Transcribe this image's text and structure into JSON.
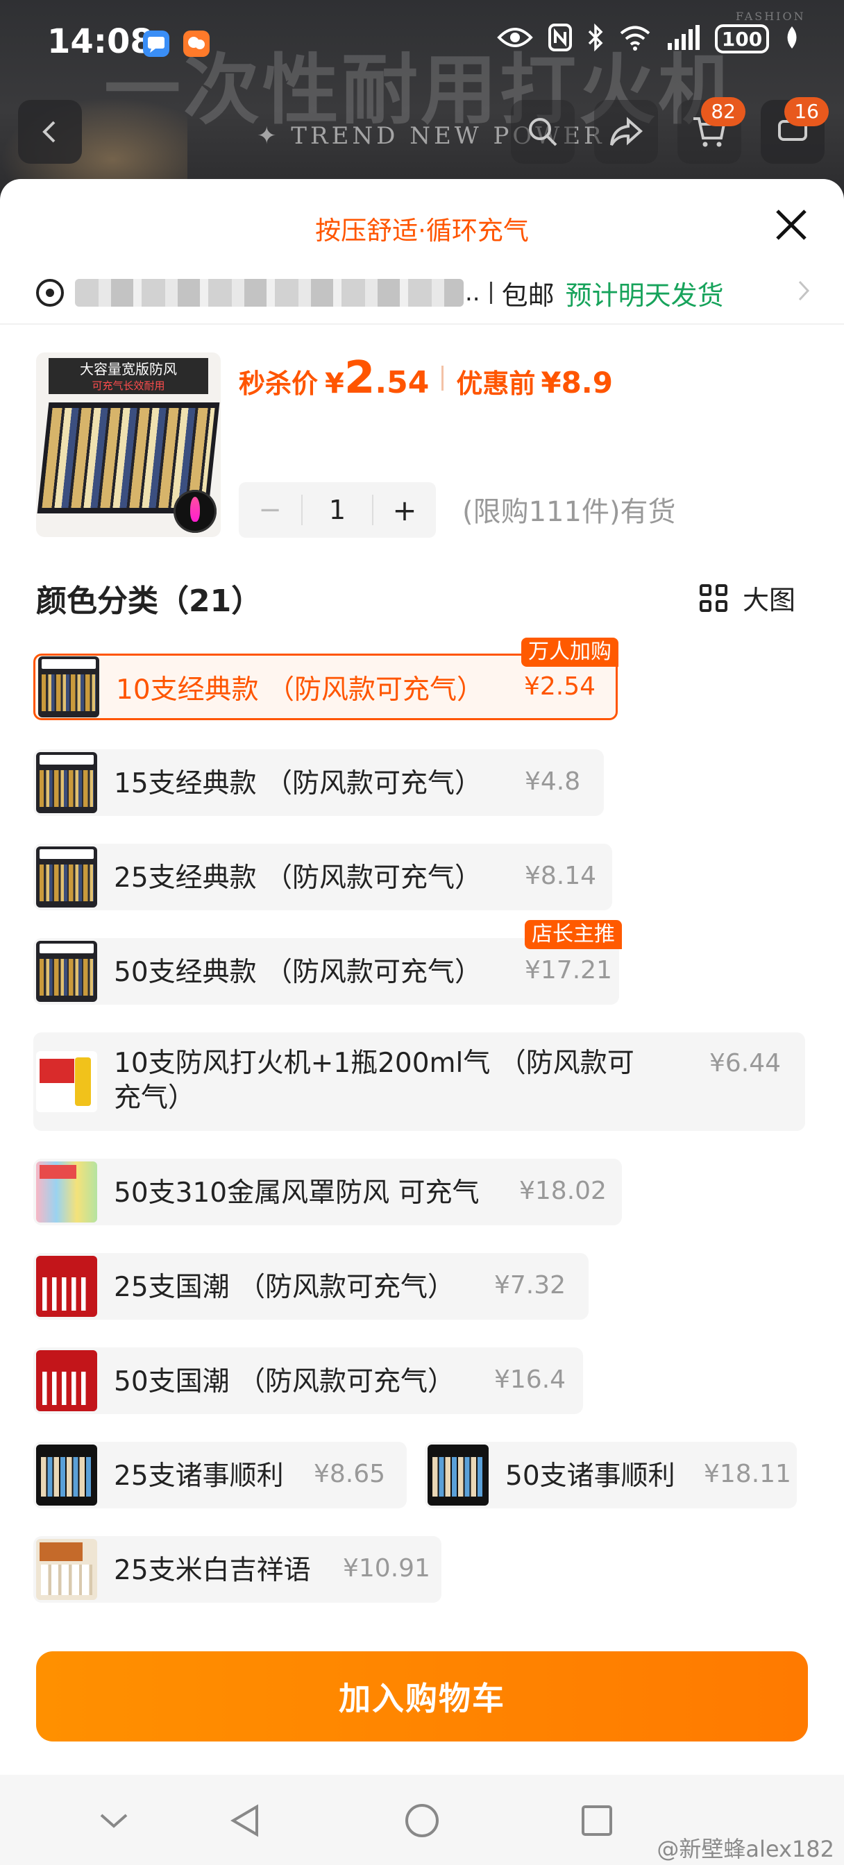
{
  "status_bar": {
    "time": "14:08",
    "battery": "100",
    "icons": [
      "message-icon",
      "chat-app-icon",
      "eye-icon",
      "nfc-icon",
      "bluetooth-icon",
      "wifi-icon",
      "signal-icon",
      "leaf-icon"
    ]
  },
  "background": {
    "banner_text": "一次性耐用打火机",
    "banner_sub": "✦ TREND NEW POWER",
    "fashion_mark": "FASHION"
  },
  "page_nav": {
    "cart_badge": "82",
    "msg_badge": "16"
  },
  "sheet": {
    "title": "按压舒适·循环充气",
    "address": {
      "ellipsis": "..",
      "ship_label": "包邮",
      "eta": "预计明天发货"
    },
    "product": {
      "price_label": "秒杀价",
      "price_currency": "¥",
      "price_int": "2",
      "price_dec": ".54",
      "orig_label": "优惠前",
      "orig_value": "¥8.9",
      "thumb_label": "大容量宽版防风",
      "thumb_sub": "可充气长效耐用",
      "quantity": "1",
      "minus": "−",
      "plus": "+",
      "stock": "(限购111件)有货"
    },
    "variants_title": "颜色分类（21）",
    "big_view": "大图",
    "variants": [
      {
        "name": "10支经典款 （防风款可充气）",
        "price": "¥2.54",
        "badge": "万人加购",
        "selected": true
      },
      {
        "name": "15支经典款 （防风款可充气）",
        "price": "¥4.8"
      },
      {
        "name": "25支经典款 （防风款可充气）",
        "price": "¥8.14"
      },
      {
        "name": "50支经典款 （防风款可充气）",
        "price": "¥17.21",
        "badge": "店长主推"
      },
      {
        "name": "10支防风打火机+1瓶200ml气 （防风款可充气）",
        "price": "¥6.44"
      },
      {
        "name": "50支310金属风罩防风 可充气",
        "price": "¥18.02"
      },
      {
        "name": "25支国潮 （防风款可充气）",
        "price": "¥7.32"
      },
      {
        "name": "50支国潮 （防风款可充气）",
        "price": "¥16.4"
      },
      {
        "name": "25支诸事顺利",
        "price": "¥8.65"
      },
      {
        "name": "50支诸事顺利",
        "price": "¥18.11"
      },
      {
        "name": "25支米白吉祥语",
        "price": "¥10.91"
      }
    ],
    "add_to_cart": "加入购物车"
  },
  "watermark": "@新壁蜂alex182",
  "colors": {
    "accent": "#ff5500",
    "cart_button": "#ff8800",
    "eta_green": "#17a35b"
  }
}
